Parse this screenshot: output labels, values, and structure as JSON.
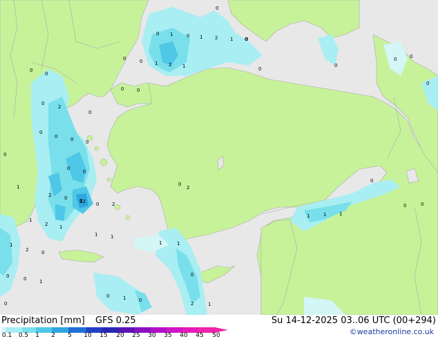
{
  "footer": {
    "title": "Precipitation [mm]",
    "model": "GFS 0.25",
    "valid_time": "Su 14-12-2025 03..06 UTC (00+294)",
    "credit": "©weatheronline.co.uk"
  },
  "legend": {
    "values": [
      "0.1",
      "0.5",
      "1",
      "2",
      "5",
      "10",
      "15",
      "20",
      "25",
      "30",
      "35",
      "40",
      "45",
      "50"
    ],
    "colors": [
      "#d3f6f7",
      "#a9eef2",
      "#78dfeb",
      "#4fc7e6",
      "#2fa6df",
      "#1f6fd6",
      "#1f3fc6",
      "#2a26b3",
      "#5b13b8",
      "#8a0fc2",
      "#b20fc8",
      "#d314c8",
      "#e41ab9",
      "#f024a8"
    ]
  },
  "map": {
    "colors": {
      "sea": "#e8e8e8",
      "land": "#c7f29a",
      "border": "#a9a9a9"
    },
    "labels": [
      "0",
      "0",
      "1",
      "0",
      "1",
      "2",
      "1",
      "0",
      "0",
      "1",
      "2",
      "1",
      "0",
      "0",
      "0",
      "0",
      "0",
      "0",
      "0",
      "0",
      "0",
      "0",
      "0",
      "0",
      "0",
      "0",
      "0",
      "0",
      "0",
      "0",
      "0",
      "2",
      "0",
      "0",
      "0",
      "1",
      "2",
      "0",
      "0",
      "0",
      "2",
      "1",
      "2",
      "1",
      "12",
      "1",
      "1",
      "1",
      "2",
      "0",
      "0",
      "0",
      "1",
      "1",
      "1",
      "0",
      "0",
      "1",
      "0",
      "0",
      "2",
      "1",
      "1",
      "1",
      "1",
      "0",
      "2",
      "0"
    ]
  }
}
